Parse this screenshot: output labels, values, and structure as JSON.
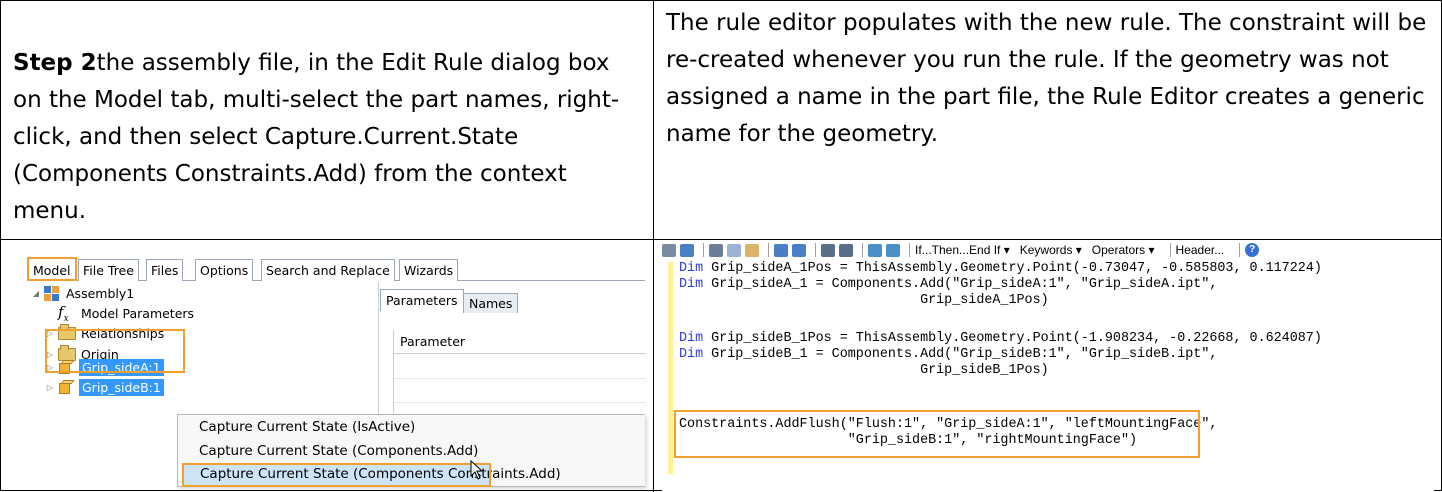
{
  "step": {
    "label": "Step 2",
    "text": "the assembly file, in the Edit Rule dialog box on the Model tab, multi-select the part names, right-click, and then select Capture.Current.State (Components Constraints.Add) from the context menu."
  },
  "result_text": "The rule editor populates with the new rule. The constraint will be re-created whenever you run the rule. If the geometry was not assigned a name in the part file, the Rule Editor creates a generic name for the geometry.",
  "edit_rule_dialog": {
    "tabs": [
      "Model",
      "File Tree",
      "Files",
      "Options",
      "Search and Replace",
      "Wizards"
    ],
    "tree": {
      "root": "Assembly1",
      "items": [
        "Model Parameters",
        "Relationships",
        "Origin",
        "Grip_sideA:1",
        "Grip_sideB:1"
      ]
    },
    "param_tabs": [
      "Parameters",
      "Names"
    ],
    "param_column": "Parameter",
    "context_menu": [
      "Capture Current State (IsActive)",
      "Capture Current State (Components.Add)",
      "Capture Current State (Components Constraints.Add)"
    ]
  },
  "rule_editor": {
    "toolbar": {
      "if_then": "If...Then...End If",
      "keywords": "Keywords",
      "operators": "Operators",
      "header": "Header..."
    },
    "code": {
      "kw_dim": "Dim",
      "l1": " Grip_sideA_1Pos = ThisAssembly.Geometry.Point(-0.73047, -0.585803, 0.117224)",
      "l2": " Grip_sideA_1 = Components.Add(\"Grip_sideA:1\", \"Grip_sideA.ipt\",",
      "l3": "                              Grip_sideA_1Pos)",
      "l4": " Grip_sideB_1Pos = ThisAssembly.Geometry.Point(-1.908234, -0.22668, 0.624087)",
      "l5": " Grip_sideB_1 = Components.Add(\"Grip_sideB:1\", \"Grip_sideB.ipt\",",
      "l6": "                              Grip_sideB_1Pos)",
      "l7": "Constraints.AddFlush(\"Flush:1\", \"Grip_sideA:1\", \"leftMountingFace\",",
      "l8": "                     \"Grip_sideB:1\", \"rightMountingFace\")"
    }
  },
  "colors": {
    "highlight_box": "#f0a030",
    "selection": "#3399ff",
    "keyword": "#2f3fd6",
    "editor_margin": "#fff09a"
  }
}
